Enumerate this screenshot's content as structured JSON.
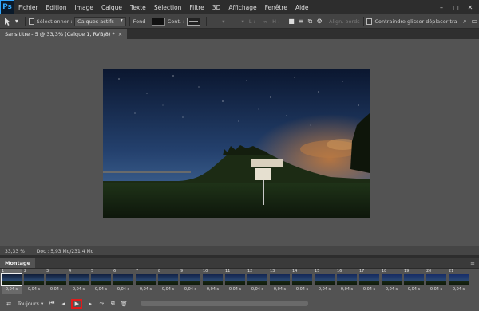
{
  "app": {
    "logo": "Ps"
  },
  "menu": [
    "Fichier",
    "Edition",
    "Image",
    "Calque",
    "Texte",
    "Sélection",
    "Filtre",
    "3D",
    "Affichage",
    "Fenêtre",
    "Aide"
  ],
  "options": {
    "select_label": "Sélectionner :",
    "select_value": "Calques actifs",
    "fill_label": "Fond :",
    "stroke_label": "Cont. :",
    "align_edges": "Align. bords",
    "constrain": "Contraindre glisser-déplacer tra"
  },
  "document": {
    "tab_title": "Sans titre - 5 @ 33,3% (Calque 1, RVB/8) *",
    "close": "×"
  },
  "status": {
    "zoom": "33,33 %",
    "doc": "Doc : 5,93 Mo/231,4 Mo"
  },
  "timeline": {
    "panel_title": "Montage",
    "loop": "Toujours",
    "frames": [
      {
        "num": "1",
        "delay": "0,04 s"
      },
      {
        "num": "2",
        "delay": "0,04 s"
      },
      {
        "num": "3",
        "delay": "0,04 s"
      },
      {
        "num": "4",
        "delay": "0,04 s"
      },
      {
        "num": "5",
        "delay": "0,04 s"
      },
      {
        "num": "6",
        "delay": "0,04 s"
      },
      {
        "num": "7",
        "delay": "0,04 s"
      },
      {
        "num": "8",
        "delay": "0,04 s"
      },
      {
        "num": "9",
        "delay": "0,04 s"
      },
      {
        "num": "10",
        "delay": "0,04 s"
      },
      {
        "num": "11",
        "delay": "0,04 s"
      },
      {
        "num": "12",
        "delay": "0,04 s"
      },
      {
        "num": "13",
        "delay": "0,04 s"
      },
      {
        "num": "14",
        "delay": "0,04 s"
      },
      {
        "num": "15",
        "delay": "0,04 s"
      },
      {
        "num": "16",
        "delay": "0,04 s"
      },
      {
        "num": "17",
        "delay": "0,04 s"
      },
      {
        "num": "18",
        "delay": "0,04 s"
      },
      {
        "num": "19",
        "delay": "0,04 s"
      },
      {
        "num": "20",
        "delay": "0,04 s"
      },
      {
        "num": "21",
        "delay": "0,04 s"
      }
    ]
  },
  "colors": {
    "accent_play_border": "#e01b1b",
    "sky_top": "#0d1a33",
    "sky_bottom": "#3a5c8a"
  }
}
